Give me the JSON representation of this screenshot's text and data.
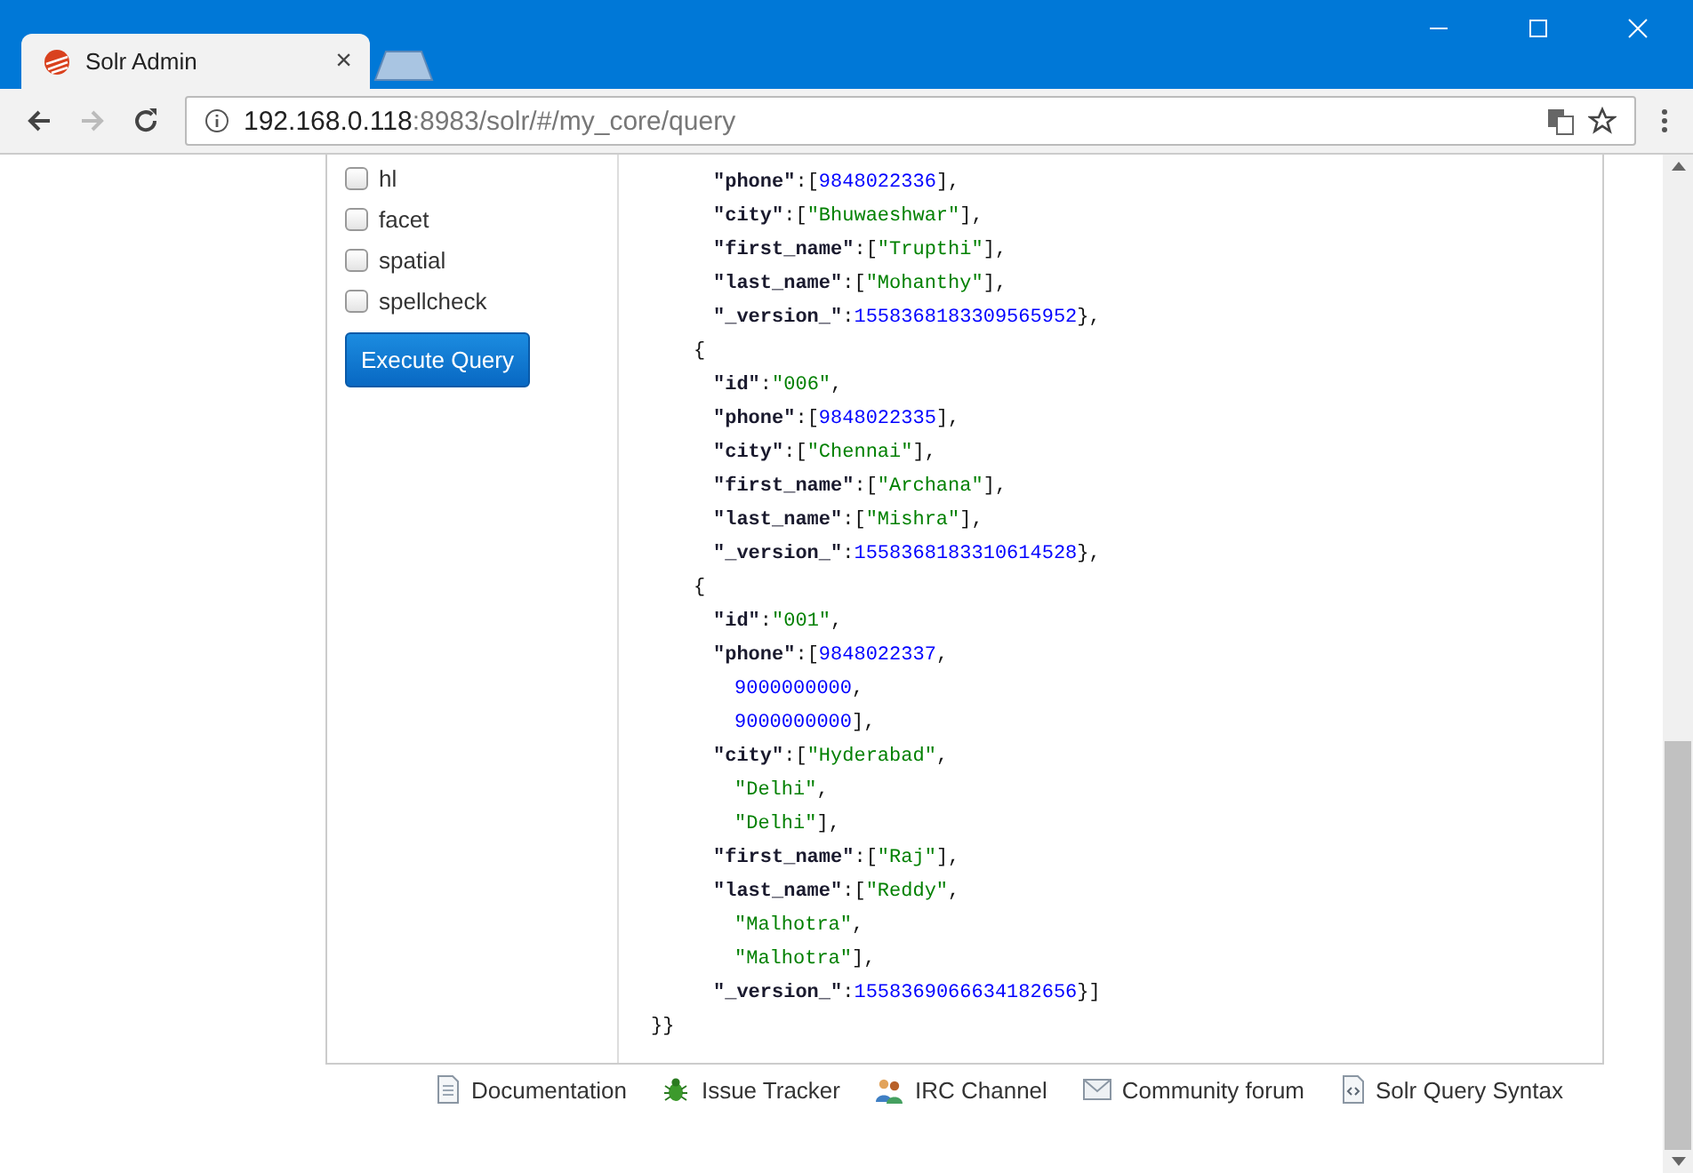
{
  "browser": {
    "tab": {
      "title": "Solr Admin",
      "close": "×"
    },
    "address": {
      "host": "192.168.0.118",
      "rest": ":8983/solr/#/my_core/query"
    }
  },
  "query_options": [
    {
      "label": "hl",
      "checked": false
    },
    {
      "label": "facet",
      "checked": false
    },
    {
      "label": "spatial",
      "checked": false
    },
    {
      "label": "spellcheck",
      "checked": false
    }
  ],
  "execute_button": "Execute Query",
  "response": {
    "docs": [
      {
        "fields": [
          {
            "tokens": [
              {
                "kind": "key",
                "text": "\"phone\""
              },
              {
                "kind": "punct",
                "text": ":["
              },
              {
                "kind": "number",
                "text": "9848022336"
              },
              {
                "kind": "punct",
                "text": "],"
              }
            ]
          },
          {
            "tokens": [
              {
                "kind": "key",
                "text": "\"city\""
              },
              {
                "kind": "punct",
                "text": ":["
              },
              {
                "kind": "string",
                "text": "\"Bhuwaeshwar\""
              },
              {
                "kind": "punct",
                "text": "],"
              }
            ]
          },
          {
            "tokens": [
              {
                "kind": "key",
                "text": "\"first_name\""
              },
              {
                "kind": "punct",
                "text": ":["
              },
              {
                "kind": "string",
                "text": "\"Trupthi\""
              },
              {
                "kind": "punct",
                "text": "],"
              }
            ]
          },
          {
            "tokens": [
              {
                "kind": "key",
                "text": "\"last_name\""
              },
              {
                "kind": "punct",
                "text": ":["
              },
              {
                "kind": "string",
                "text": "\"Mohanthy\""
              },
              {
                "kind": "punct",
                "text": "],"
              }
            ]
          },
          {
            "tokens": [
              {
                "kind": "key",
                "text": "\"_version_\""
              },
              {
                "kind": "punct",
                "text": ":"
              },
              {
                "kind": "number",
                "text": "1558368183309565952"
              },
              {
                "kind": "punct",
                "text": "},"
              }
            ]
          }
        ]
      },
      {
        "open": "{",
        "fields": [
          {
            "tokens": [
              {
                "kind": "key",
                "text": "\"id\""
              },
              {
                "kind": "punct",
                "text": ":"
              },
              {
                "kind": "string",
                "text": "\"006\""
              },
              {
                "kind": "punct",
                "text": ","
              }
            ]
          },
          {
            "tokens": [
              {
                "kind": "key",
                "text": "\"phone\""
              },
              {
                "kind": "punct",
                "text": ":["
              },
              {
                "kind": "number",
                "text": "9848022335"
              },
              {
                "kind": "punct",
                "text": "],"
              }
            ]
          },
          {
            "tokens": [
              {
                "kind": "key",
                "text": "\"city\""
              },
              {
                "kind": "punct",
                "text": ":["
              },
              {
                "kind": "string",
                "text": "\"Chennai\""
              },
              {
                "kind": "punct",
                "text": "],"
              }
            ]
          },
          {
            "tokens": [
              {
                "kind": "key",
                "text": "\"first_name\""
              },
              {
                "kind": "punct",
                "text": ":["
              },
              {
                "kind": "string",
                "text": "\"Archana\""
              },
              {
                "kind": "punct",
                "text": "],"
              }
            ]
          },
          {
            "tokens": [
              {
                "kind": "key",
                "text": "\"last_name\""
              },
              {
                "kind": "punct",
                "text": ":["
              },
              {
                "kind": "string",
                "text": "\"Mishra\""
              },
              {
                "kind": "punct",
                "text": "],"
              }
            ]
          },
          {
            "tokens": [
              {
                "kind": "key",
                "text": "\"_version_\""
              },
              {
                "kind": "punct",
                "text": ":"
              },
              {
                "kind": "number",
                "text": "1558368183310614528"
              },
              {
                "kind": "punct",
                "text": "},"
              }
            ]
          }
        ]
      },
      {
        "open": "{",
        "fields": [
          {
            "tokens": [
              {
                "kind": "key",
                "text": "\"id\""
              },
              {
                "kind": "punct",
                "text": ":"
              },
              {
                "kind": "string",
                "text": "\"001\""
              },
              {
                "kind": "punct",
                "text": ","
              }
            ]
          },
          {
            "tokens": [
              {
                "kind": "key",
                "text": "\"phone\""
              },
              {
                "kind": "punct",
                "text": ":["
              },
              {
                "kind": "number",
                "text": "9848022337"
              },
              {
                "kind": "punct",
                "text": ","
              }
            ],
            "children": [
              {
                "tokens": [
                  {
                    "kind": "number",
                    "text": "9000000000"
                  },
                  {
                    "kind": "punct",
                    "text": ","
                  }
                ]
              },
              {
                "tokens": [
                  {
                    "kind": "number",
                    "text": "9000000000"
                  },
                  {
                    "kind": "punct",
                    "text": "],"
                  }
                ]
              }
            ]
          },
          {
            "tokens": [
              {
                "kind": "key",
                "text": "\"city\""
              },
              {
                "kind": "punct",
                "text": ":["
              },
              {
                "kind": "string",
                "text": "\"Hyderabad\""
              },
              {
                "kind": "punct",
                "text": ","
              }
            ],
            "children": [
              {
                "tokens": [
                  {
                    "kind": "string",
                    "text": "\"Delhi\""
                  },
                  {
                    "kind": "punct",
                    "text": ","
                  }
                ]
              },
              {
                "tokens": [
                  {
                    "kind": "string",
                    "text": "\"Delhi\""
                  },
                  {
                    "kind": "punct",
                    "text": "],"
                  }
                ]
              }
            ]
          },
          {
            "tokens": [
              {
                "kind": "key",
                "text": "\"first_name\""
              },
              {
                "kind": "punct",
                "text": ":["
              },
              {
                "kind": "string",
                "text": "\"Raj\""
              },
              {
                "kind": "punct",
                "text": "],"
              }
            ]
          },
          {
            "tokens": [
              {
                "kind": "key",
                "text": "\"last_name\""
              },
              {
                "kind": "punct",
                "text": ":["
              },
              {
                "kind": "string",
                "text": "\"Reddy\""
              },
              {
                "kind": "punct",
                "text": ","
              }
            ],
            "children": [
              {
                "tokens": [
                  {
                    "kind": "string",
                    "text": "\"Malhotra\""
                  },
                  {
                    "kind": "punct",
                    "text": ","
                  }
                ]
              },
              {
                "tokens": [
                  {
                    "kind": "string",
                    "text": "\"Malhotra\""
                  },
                  {
                    "kind": "punct",
                    "text": "],"
                  }
                ]
              }
            ]
          },
          {
            "tokens": [
              {
                "kind": "key",
                "text": "\"_version_\""
              },
              {
                "kind": "punct",
                "text": ":"
              },
              {
                "kind": "number",
                "text": "1558369066634182656"
              },
              {
                "kind": "punct",
                "text": "}]"
              }
            ]
          }
        ]
      }
    ],
    "close": "}}"
  },
  "footer_links": [
    {
      "label": "Documentation",
      "kind": "docs"
    },
    {
      "label": "Issue Tracker",
      "kind": "issues"
    },
    {
      "label": "IRC Channel",
      "kind": "chat"
    },
    {
      "label": "Community forum",
      "kind": "forum"
    },
    {
      "label": "Solr Query Syntax",
      "kind": "syntax"
    }
  ]
}
